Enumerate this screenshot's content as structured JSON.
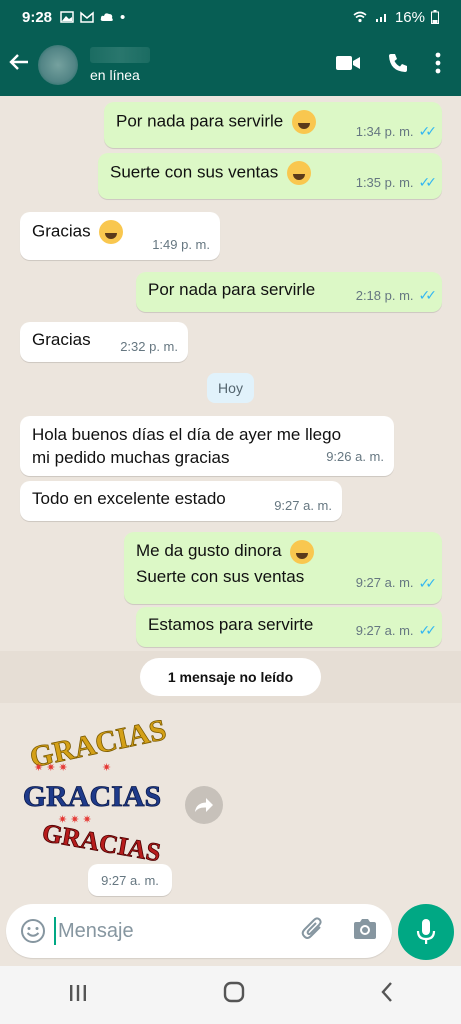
{
  "status_bar": {
    "time": "9:28",
    "battery": "16%"
  },
  "header": {
    "presence": "en línea"
  },
  "messages": [
    {
      "text": "Por nada para servirle",
      "time": "1:34 p. m."
    },
    {
      "text": "Suerte con sus ventas",
      "time": "1:35 p. m."
    },
    {
      "text": "Gracias",
      "time": "1:49 p. m."
    },
    {
      "text": "Por nada para servirle",
      "time": "2:18 p. m."
    },
    {
      "text": "Gracias",
      "time": "2:32 p. m."
    },
    {
      "text": "Hola buenos días el día de ayer me llego mi pedido muchas gracias",
      "time": "9:26 a. m."
    },
    {
      "text": "Todo en excelente estado",
      "time": "9:27 a. m."
    },
    {
      "text": "Me da gusto dinora",
      "text2": "Suerte con sus ventas",
      "time": "9:27 a. m."
    },
    {
      "text": "Estamos para servirte",
      "time": "9:27 a. m."
    }
  ],
  "date_separator": "Hoy",
  "unread_banner": "1 mensaje no leído",
  "sticker": {
    "words": [
      "GRACIAS",
      "GRACIAS",
      "GRACIAS"
    ],
    "time": "9:27 a. m."
  },
  "input": {
    "placeholder": "Mensaje"
  },
  "icons": {
    "back": "arrow-left-icon",
    "video": "video-call-icon",
    "call": "phone-icon",
    "menu": "more-vert-icon",
    "emoji": "emoji-icon",
    "attach": "paperclip-icon",
    "camera": "camera-icon",
    "mic": "mic-icon",
    "forward": "forward-icon"
  },
  "colors": {
    "header": "#075e54",
    "outgoing": "#dcf8c6",
    "incoming": "#ffffff",
    "accent": "#00a884",
    "read_ticks": "#34b7f1"
  }
}
